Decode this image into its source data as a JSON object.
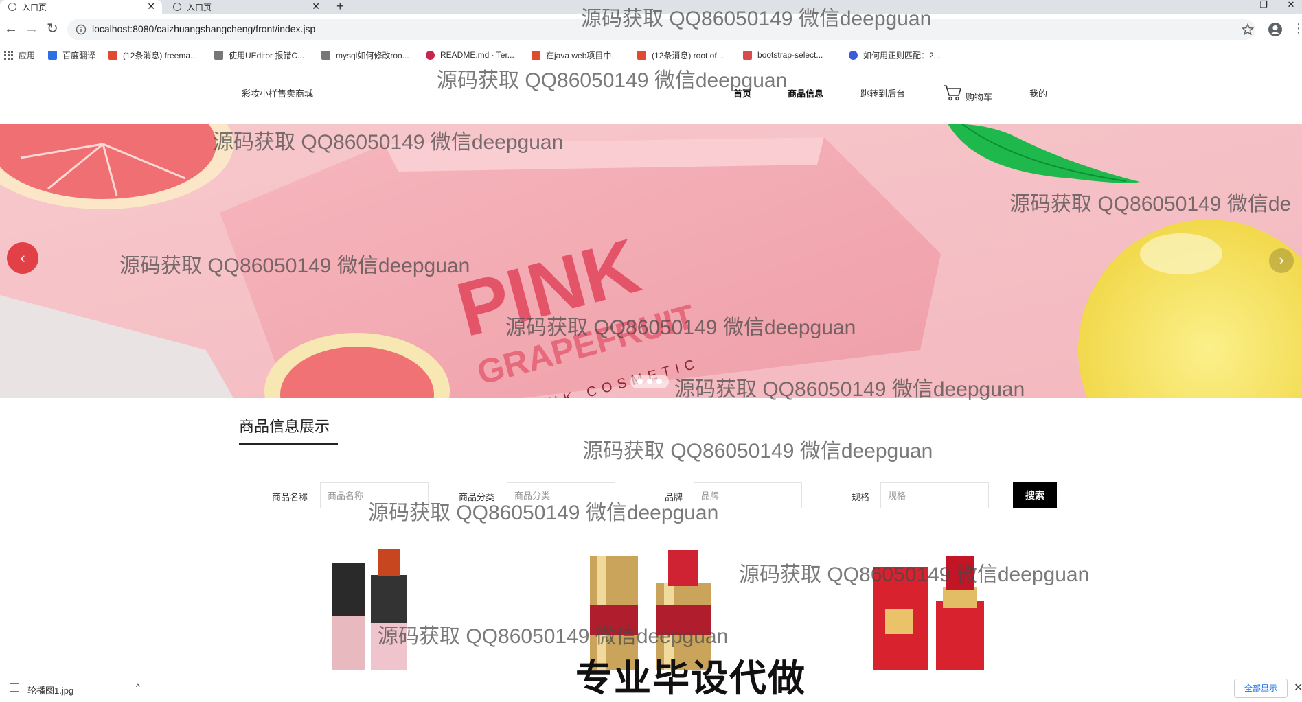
{
  "browser": {
    "tabs": [
      {
        "title": "入口页",
        "close": "✕"
      },
      {
        "title": "入口页",
        "close": "✕"
      }
    ],
    "new_tab": "+",
    "window_controls": {
      "minimize": "—",
      "restore": "❐",
      "close": "✕"
    },
    "nav": {
      "back": "←",
      "forward": "→",
      "reload": "↻"
    },
    "url": "localhost:8080/caizhuangshangcheng/front/index.jsp",
    "bookmarks": [
      {
        "label": "应用",
        "color": "#e25b45"
      },
      {
        "label": "百度翻译",
        "color": "#2f6fe4"
      },
      {
        "label": "(12条消息) freema...",
        "color": "#e04a2f"
      },
      {
        "label": "使用UEditor 报错C...",
        "color": "#555555"
      },
      {
        "label": "mysql如何修改roo...",
        "color": "#555555"
      },
      {
        "label": "README.md · Ter...",
        "color": "#c7254e"
      },
      {
        "label": "在java web项目中...",
        "color": "#e04a2f"
      },
      {
        "label": "(12条消息) root of...",
        "color": "#e04a2f"
      },
      {
        "label": "bootstrap-select...",
        "color": "#d94c4c"
      },
      {
        "label": "如何用正则匹配：2...",
        "color": "#3b5bdb"
      }
    ]
  },
  "site": {
    "title": "彩妆小样售卖商城",
    "nav": [
      {
        "label": "首页"
      },
      {
        "label": "商品信息"
      },
      {
        "label": "跳转到后台"
      },
      {
        "label": "购物车"
      },
      {
        "label": "我的"
      }
    ]
  },
  "banner": {
    "headline": "PINK",
    "subline": "GRAPEFRUIT",
    "tagline": "PINK COSMETIC",
    "arrow_left": "‹",
    "arrow_right": "›"
  },
  "section": {
    "title": "商品信息展示"
  },
  "search": {
    "fields": [
      {
        "label": "商品名称",
        "placeholder": "商品名称"
      },
      {
        "label": "商品分类",
        "placeholder": "商品分类"
      },
      {
        "label": "品牌",
        "placeholder": "品牌"
      },
      {
        "label": "规格",
        "placeholder": "规格"
      }
    ],
    "button": "搜索"
  },
  "downloads": {
    "file": "轮播图1.jpg",
    "chevron": "^",
    "show_all": "全部显示",
    "close": "✕"
  },
  "watermark": "源码获取 QQ86050149 微信deepguan",
  "watermark_cut": "源码获取 QQ86050149 微信de",
  "promo": "专业毕设代做"
}
